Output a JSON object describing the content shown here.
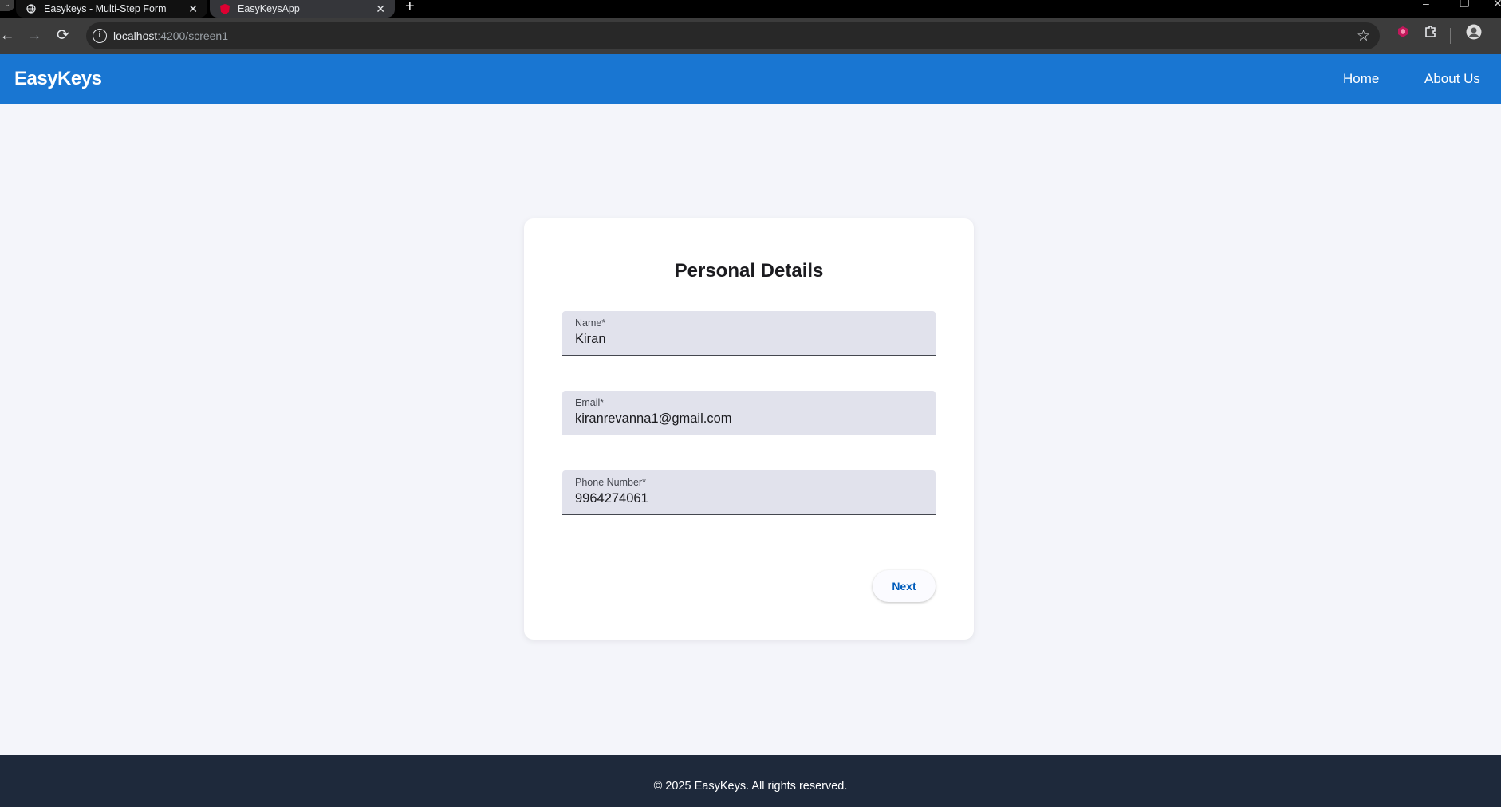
{
  "browser": {
    "tabs": [
      {
        "title": "Easykeys - Multi-Step Form",
        "active": false
      },
      {
        "title": "EasyKeysApp",
        "active": true
      }
    ],
    "url_host": "localhost",
    "url_path": ":4200/screen1",
    "icons": {
      "back": "arrow-left-icon",
      "forward": "arrow-right-icon",
      "reload": "reload-icon",
      "info": "info-icon",
      "star": "star-icon",
      "extension": "puzzle-icon",
      "profile": "avatar-icon"
    }
  },
  "header": {
    "brand": "EasyKeys",
    "nav": [
      {
        "label": "Home"
      },
      {
        "label": "About Us"
      }
    ],
    "color": "#1976d2"
  },
  "form": {
    "title": "Personal Details",
    "fields": [
      {
        "label": "Name*",
        "value": "Kiran"
      },
      {
        "label": "Email*",
        "value": "kiranrevanna1@gmail.com"
      },
      {
        "label": "Phone Number*",
        "value": "9964274061"
      }
    ],
    "next_label": "Next"
  },
  "footer": {
    "text": "© 2025 EasyKeys. All rights reserved.",
    "color": "#1e293b"
  }
}
